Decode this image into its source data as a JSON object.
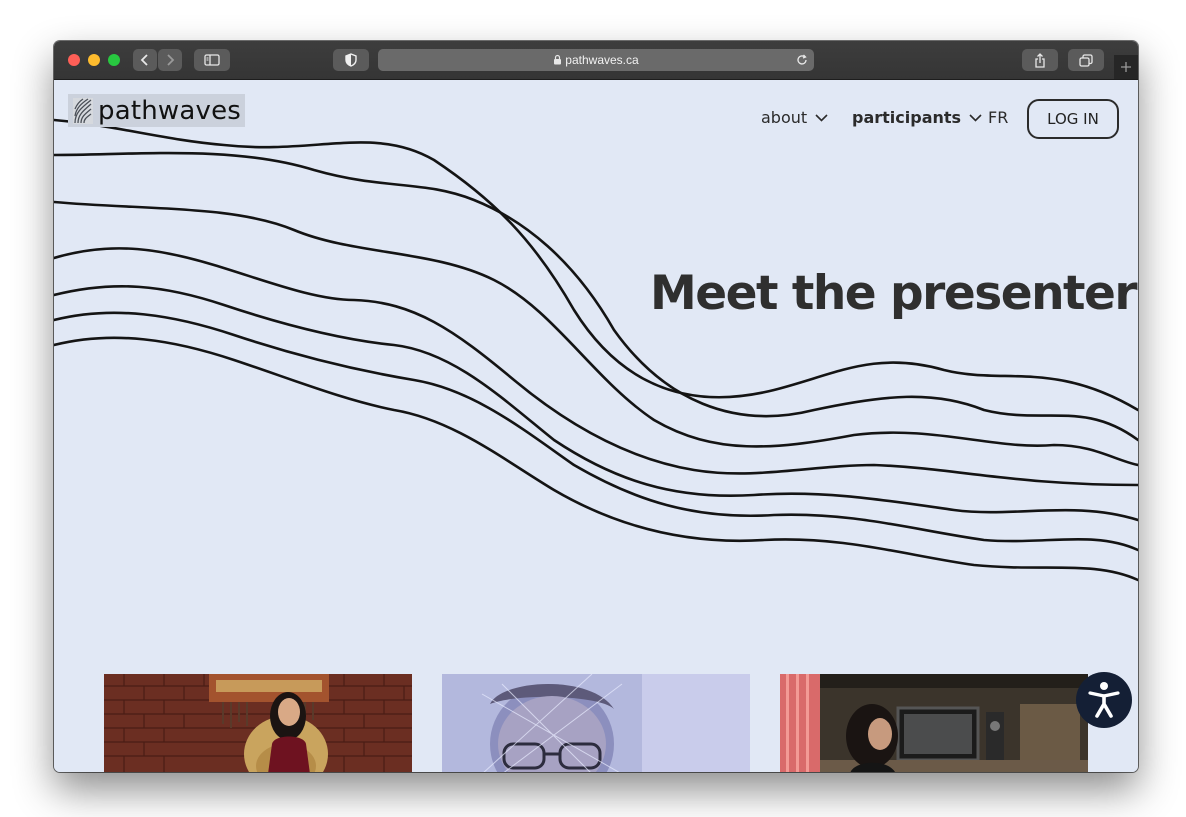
{
  "browser": {
    "url": "pathwaves.ca",
    "icons": [
      "back-chevron-icon",
      "forward-chevron-icon",
      "sidebar-icon",
      "shield-icon",
      "lock-icon",
      "reload-icon",
      "share-icon",
      "tabs-icon",
      "new-tab-plus-icon"
    ]
  },
  "site": {
    "logo_text": "pathwaves",
    "nav": {
      "about": "about",
      "participants": "participants",
      "lang": "FR",
      "login": "LOG IN"
    },
    "hero_title": "Meet the presenters"
  },
  "colors": {
    "page_bg": "#e1e8f5",
    "text": "#2f2f2f",
    "a11y_button": "#141f35"
  },
  "presenters": [
    {
      "photo": "woman-seated-brick-wall-photo"
    },
    {
      "photo": "man-glasses-blue-tint-photo"
    },
    {
      "photo": "woman-recording-studio-photo"
    }
  ]
}
